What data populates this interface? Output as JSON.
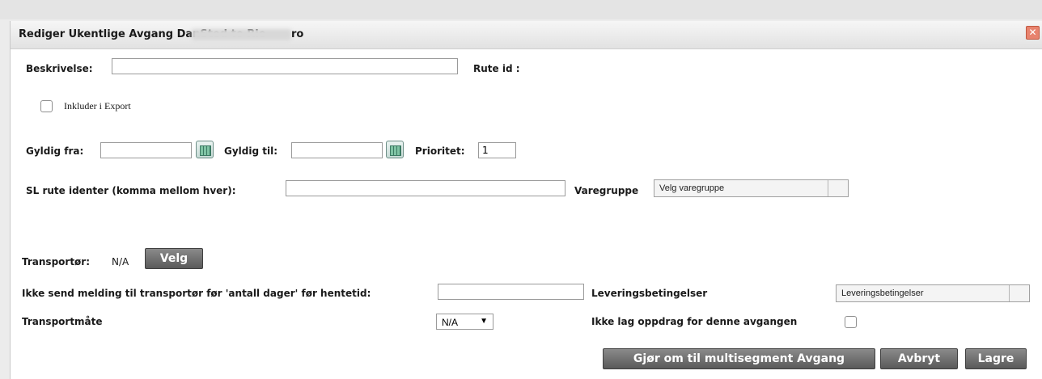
{
  "dialog": {
    "title": "Rediger Ukentlige Avgang DanSted to Rie",
    "title_tail": "ro",
    "close_glyph": "✕"
  },
  "form": {
    "beskrivelse_label": "Beskrivelse:",
    "beskrivelse_value": "",
    "rute_id_label": "Rute id :",
    "inkluder_label": "Inkluder i Export",
    "gyldig_fra_label": "Gyldig fra:",
    "gyldig_fra_value": "",
    "gyldig_til_label": "Gyldig til:",
    "gyldig_til_value": "",
    "prioritet_label": "Prioritet:",
    "prioritet_value": "1",
    "sl_rute_label": "SL rute identer (komma mellom hver):",
    "sl_rute_value": "",
    "varegruppe_label": "Varegruppe",
    "varegruppe_selected": "Velg varegruppe",
    "transportor_label": "Transportør:",
    "transportor_value": "N/A",
    "velg_button": "Velg",
    "ikke_send_label": "Ikke send melding til transportør før 'antall dager' før hentetid:",
    "ikke_send_value": "",
    "leveringsbetingelser_label": "Leveringsbetingelser",
    "leveringsbetingelser_selected": "Leveringsbetingelser",
    "transportmate_label": "Transportmåte",
    "transportmate_selected": "N/A",
    "ikke_lag_label": "Ikke lag oppdrag for denne avgangen"
  },
  "actions": {
    "multisegment_button": "Gjør om til multisegment Avgang",
    "avbryt_button": "Avbryt",
    "lagre_button": "Lagre"
  },
  "icons": {
    "calendar": "calendar-icon",
    "dropdown_arrow": "▼"
  }
}
